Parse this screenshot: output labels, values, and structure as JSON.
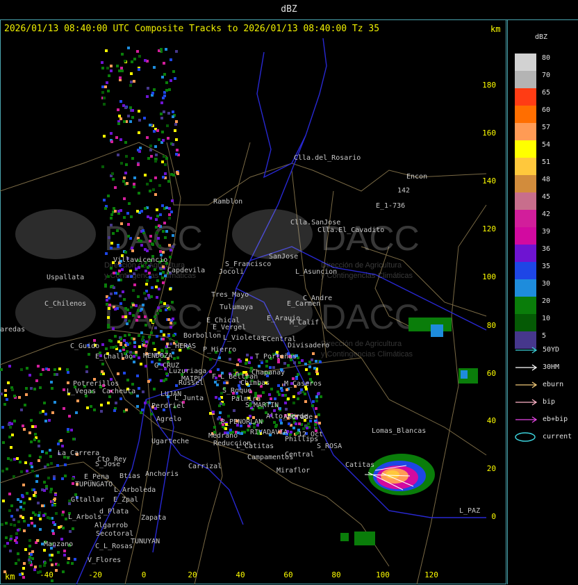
{
  "window": {
    "title": "dBZ"
  },
  "header": {
    "text": "2026/01/13 08:40:00 UTC Composite Tracks to 2026/01/13 08:40:00 Tz 35",
    "units_right": "km",
    "units_bottom": "km"
  },
  "axes": {
    "x_ticks": [
      "-40",
      "-20",
      "0",
      "20",
      "40",
      "60",
      "80",
      "100",
      "120"
    ],
    "y_ticks": [
      "180",
      "160",
      "140",
      "120",
      "100",
      "80",
      "60",
      "40",
      "20",
      "0"
    ]
  },
  "watermark": {
    "text": "DACC",
    "subtitle_1": "Dirección de Agricultura",
    "subtitle_2": "y Contingencias Climáticas"
  },
  "places": [
    "Clla.del_Rosario",
    "Encon",
    "142",
    "E_1-736",
    "Ramblon",
    "Clla.SanJose",
    "Clla.El_Cavadito",
    "SanJose",
    "S_Francisco",
    "L_Asuncion",
    "Villavicencio",
    "Uspallata",
    "Capdevila",
    "Jocoli",
    "Tres_Mayo",
    "Tulumaya",
    "C_Andre",
    "E_Carmen",
    "C_Chilenos",
    "E_Chical",
    "E_Arauio",
    "M_Calif",
    "E_Vergel",
    "Borbollon",
    "L_Violetas",
    "ECentral",
    "Divisadero",
    "L_HERAS",
    "P_Hierro",
    "C_Guido",
    "E_Challao",
    "MENDOZA",
    "G_CRUZ",
    "T_Porteñas",
    "Luzuriaga",
    "Chapanay",
    "F_L_Beltran",
    "Russel",
    "MAIPU",
    "Chimbas",
    "M_Caseros",
    "Potrerillos",
    "L_Vegas",
    "Cacheuta",
    "LUJAN",
    "L_Junta",
    "S_Roque",
    "Perdriel",
    "Palmira",
    "S_MARTIN",
    "Agrelo",
    "Alto_Verde",
    "Medrano",
    "R_PENORLAN",
    "RIVADAVIA",
    "Andrade",
    "12_Oct",
    "Ugarteche",
    "Reduccion",
    "L_Catitas",
    "Phillips",
    "S_ROSA",
    "Lomas_Blancas",
    "Carrizal",
    "Campamentos",
    "Central",
    "La_Carrera",
    "Cto_Rey",
    "S_Jose",
    "Catitas",
    "Miraflor",
    "E_Pena",
    "Btias",
    "Anchoris",
    "TUPUNGATO",
    "L_Arboleda",
    "Gltallar",
    "E_Zpal",
    "d_Plata",
    "L_Arbols",
    "Zapata",
    "Algarrob",
    "Secotoral",
    "Manzano",
    "TUNUYAN",
    "C_L_Rosas",
    "V_Flores",
    "L_PAZ",
    "aredas"
  ],
  "legend": {
    "title": "dBZ",
    "levels": [
      {
        "label": "80",
        "color": "#d2d2d2"
      },
      {
        "label": "70",
        "color": "#b4b4b4"
      },
      {
        "label": "65",
        "color": "#ff3c14"
      },
      {
        "label": "60",
        "color": "#ff6e00"
      },
      {
        "label": "57",
        "color": "#ff9b55"
      },
      {
        "label": "54",
        "color": "#ffff00"
      },
      {
        "label": "51",
        "color": "#ffc83c"
      },
      {
        "label": "48",
        "color": "#d28c3c"
      },
      {
        "label": "45",
        "color": "#c86e8c"
      },
      {
        "label": "42",
        "color": "#d21e9b"
      },
      {
        "label": "39",
        "color": "#d20aa0"
      },
      {
        "label": "36",
        "color": "#6e14d2"
      },
      {
        "label": "35",
        "color": "#1e46e6"
      },
      {
        "label": "30",
        "color": "#1e8cdc"
      },
      {
        "label": "20",
        "color": "#0a7d0a"
      },
      {
        "label": "10",
        "color": "#055a05"
      },
      {
        "label": "5",
        "color": "#46378c"
      }
    ],
    "tracks": [
      {
        "label": "50YD",
        "color": "#3cd2dc"
      },
      {
        "label": "30HM",
        "color": "#ffffff"
      },
      {
        "label": "eburn",
        "color": "#f0c878"
      },
      {
        "label": "bip",
        "color": "#ffb4c8"
      },
      {
        "label": "eb+bip",
        "color": "#e646e6"
      },
      {
        "label": "current",
        "color": "#3cd2dc"
      }
    ]
  }
}
